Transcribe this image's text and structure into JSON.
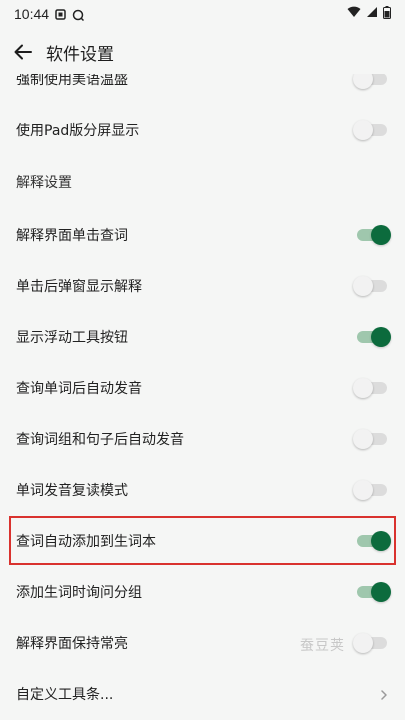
{
  "status_bar": {
    "time": "10:44"
  },
  "header": {
    "title": "软件设置"
  },
  "rows_top": [
    {
      "label": "强制使用美语温盛",
      "on": false
    },
    {
      "label": "使用Pad版分屏显示",
      "on": false
    }
  ],
  "section": {
    "title": "解释设置"
  },
  "rows": [
    {
      "label": "解释界面单击查词",
      "on": true
    },
    {
      "label": "单击后弹窗显示解释",
      "on": false
    },
    {
      "label": "显示浮动工具按钮",
      "on": true
    },
    {
      "label": "查询单词后自动发音",
      "on": false
    },
    {
      "label": "查询词组和句子后自动发音",
      "on": false
    },
    {
      "label": "单词发音复读模式",
      "on": false
    },
    {
      "label": "查词自动添加到生词本",
      "on": true
    },
    {
      "label": "添加生词时询问分组",
      "on": true
    },
    {
      "label": "解释界面保持常亮",
      "on": false
    }
  ],
  "custom_toolbar": {
    "label": "自定义工具条..."
  },
  "watermark": "蚕豆荚",
  "colors": {
    "accent": "#0c6b3d",
    "accent_track": "#9fc7ad",
    "highlight": "#d9322e"
  }
}
